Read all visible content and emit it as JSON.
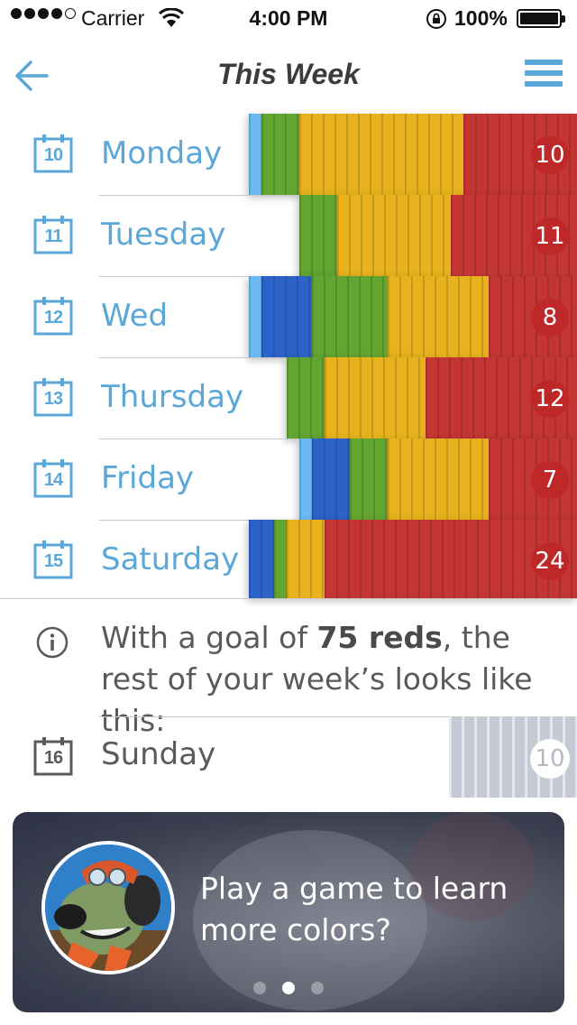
{
  "status_bar": {
    "carrier": "Carrier",
    "time": "4:00 PM",
    "battery": "100%"
  },
  "nav": {
    "title": "This Week"
  },
  "days": [
    {
      "date": "10",
      "name": "Monday",
      "count": "10"
    },
    {
      "date": "11",
      "name": "Tuesday",
      "count": "11"
    },
    {
      "date": "12",
      "name": "Wed",
      "count": "8"
    },
    {
      "date": "13",
      "name": "Thursday",
      "count": "12"
    },
    {
      "date": "14",
      "name": "Friday",
      "count": "7"
    },
    {
      "date": "15",
      "name": "Saturday",
      "count": "24"
    }
  ],
  "info": {
    "prefix": "With a goal of ",
    "goal": "75 reds",
    "suffix": ", the rest of your week’s looks like this:"
  },
  "forecast": {
    "date": "16",
    "name": "Sunday",
    "count": "10"
  },
  "game_card": {
    "text": "Play a game to learn more colors?",
    "page_count": 3,
    "active_page": 2
  },
  "colors": {
    "accent": "#5aa7d8",
    "light_blue": "#6ab9f0",
    "blue": "#2d63c9",
    "green": "#63a531",
    "yellow": "#e8b21e",
    "red": "#c43634",
    "forecast_grey": "#c4c9d4"
  },
  "icons": [
    "back-arrow-icon",
    "hamburger-menu-icon",
    "calendar-icon",
    "info-icon",
    "wifi-icon",
    "lock-rotation-icon",
    "battery-icon"
  ]
}
